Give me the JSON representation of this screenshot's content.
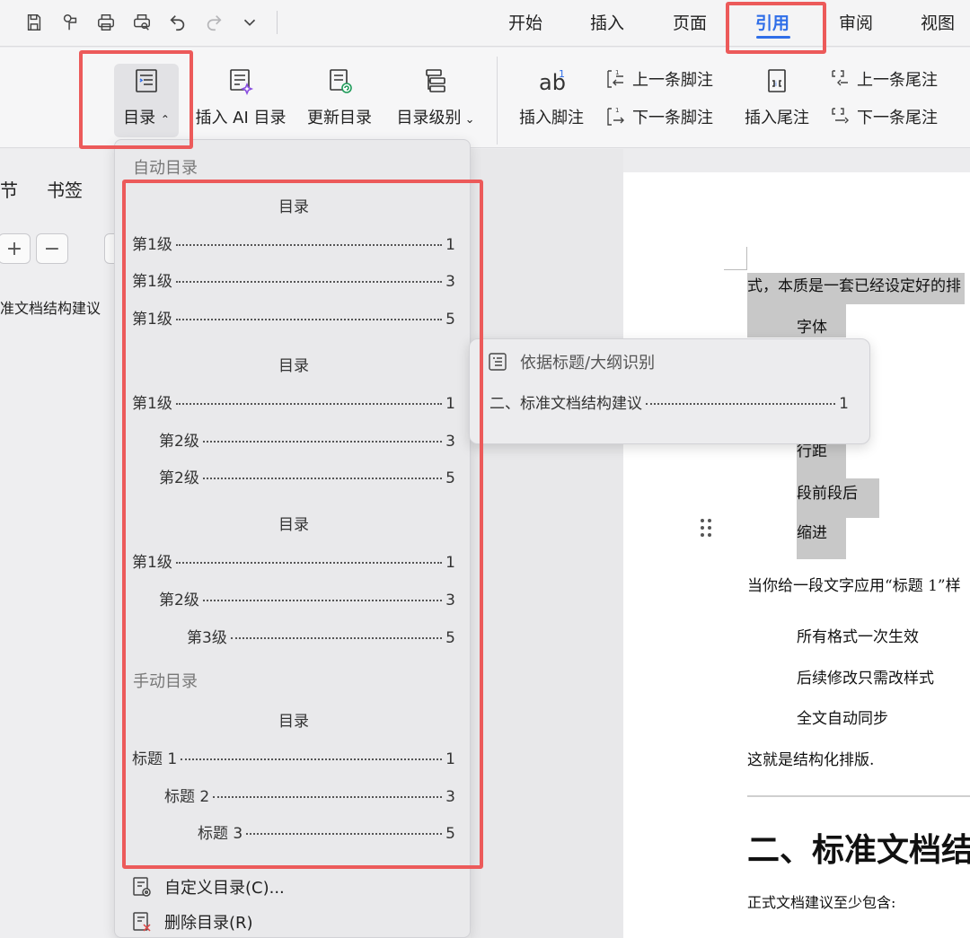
{
  "ribbon_tabs": {
    "start": "开始",
    "insert": "插入",
    "page": "页面",
    "references": "引用",
    "review": "审阅",
    "view": "视图"
  },
  "ribbon": {
    "toc": "目录",
    "insert_ai_toc": "插入 AI 目录",
    "update_toc": "更新目录",
    "toc_level": "目录级别",
    "insert_footnote": "插入脚注",
    "prev_footnote": "上一条脚注",
    "next_footnote": "下一条脚注",
    "insert_endnote": "插入尾注",
    "prev_endnote": "上一条尾注",
    "next_endnote": "下一条尾注"
  },
  "navpane": {
    "tab_sections": "节",
    "tab_bookmarks": "书签",
    "tab_third": "",
    "expand": "+",
    "collapse": "−",
    "item": "准文档结构建议"
  },
  "dropdown": {
    "auto_section": "自动目录",
    "manual_section": "手动目录",
    "toc_title": "目录",
    "templates": [
      {
        "rows": [
          {
            "text": "第1级",
            "page": "1"
          },
          {
            "text": "第1级",
            "page": "3"
          },
          {
            "text": "第1级",
            "page": "5"
          }
        ]
      },
      {
        "rows": [
          {
            "text": "第1级",
            "page": "1"
          },
          {
            "text": "第2级",
            "page": "3"
          },
          {
            "text": "第2级",
            "page": "5"
          }
        ]
      },
      {
        "rows": [
          {
            "text": "第1级",
            "page": "1"
          },
          {
            "text": "第2级",
            "page": "3"
          },
          {
            "text": "第3级",
            "page": "5"
          }
        ]
      }
    ],
    "manual_rows": [
      {
        "text": "标题 1",
        "page": "1"
      },
      {
        "text": "标题 2",
        "page": "3"
      },
      {
        "text": "标题 3",
        "page": "5"
      }
    ],
    "custom_toc": "自定义目录(C)...",
    "delete_toc": "删除目录(R)"
  },
  "popup": {
    "header": "依据标题/大纲识别",
    "entry_text": "二、标准文档结构建议",
    "entry_page": "1"
  },
  "document": {
    "line1": "式，本质是一套已经设定好的排",
    "item_font": "字体",
    "item_spacing": "行距",
    "item_para": "段前段后",
    "item_indent": "缩进",
    "apply_line": "当你给一段文字应用“标题 1”样",
    "bullet1": "所有格式一次生效",
    "bullet2": "后续修改只需改样式",
    "bullet3": "全文自动同步",
    "conclusion": "这就是结构化排版.",
    "heading2": "二、标准文档结",
    "formal": "正式文档建议至少包含:"
  },
  "colors": {
    "accent": "#2f6ee8",
    "annotation_red": "#ec5a5a"
  }
}
